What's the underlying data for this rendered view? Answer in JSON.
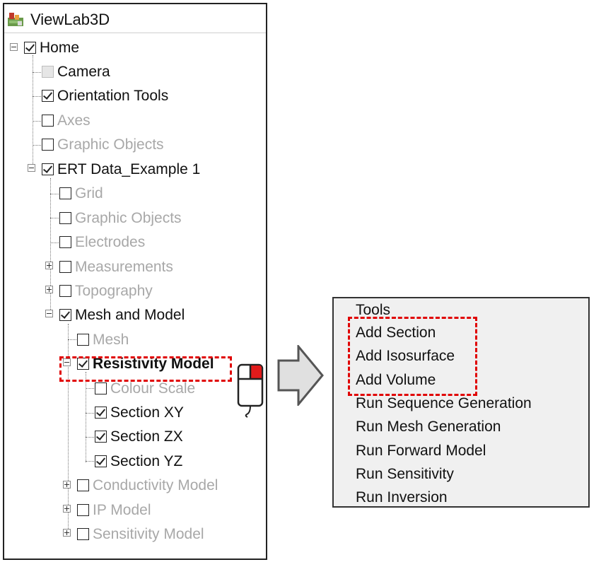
{
  "app": {
    "title": "ViewLab3D"
  },
  "tree": {
    "home": "Home",
    "camera": "Camera",
    "orientation_tools": "Orientation Tools",
    "axes": "Axes",
    "graphic_objects": "Graphic Objects",
    "dataset": "ERT Data_Example 1",
    "grid": "Grid",
    "dataset_graphic_objects": "Graphic Objects",
    "electrodes": "Electrodes",
    "measurements": "Measurements",
    "topography": "Topography",
    "mesh_and_model": "Mesh and Model",
    "mesh": "Mesh",
    "resistivity_model": "Resistivity Model",
    "colour_scale": "Colour Scale",
    "section_xy": "Section XY",
    "section_zx": "Section ZX",
    "section_yz": "Section YZ",
    "conductivity_model": "Conductivity Model",
    "ip_model": "IP Model",
    "sensitivity_model": "Sensitivity Model"
  },
  "context_menu": {
    "items": [
      "Tools",
      "Add Section",
      "Add Isosurface",
      "Add Volume",
      "Run Sequence Generation",
      "Run Mesh Generation",
      "Run Forward Model",
      "Run Sensitivity",
      "Run Inversion"
    ]
  },
  "colors": {
    "highlight": "#e00000",
    "disabled_text": "#a8a8a8",
    "menu_bg": "#f0f0f0"
  }
}
